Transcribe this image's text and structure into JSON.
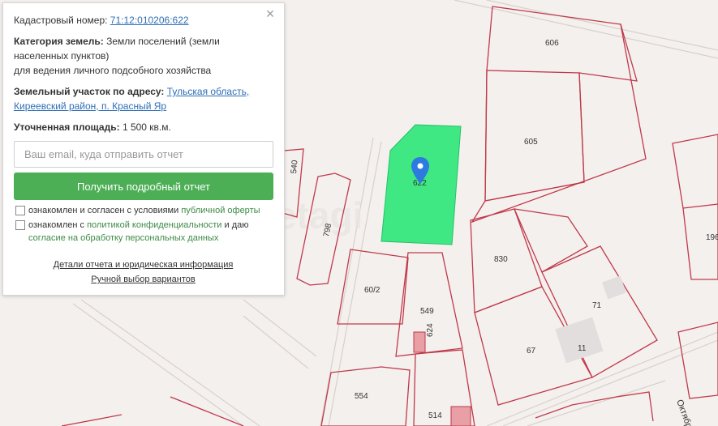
{
  "panel": {
    "close_symbol": "×",
    "cadastral_label": "Кадастровый номер:",
    "cadastral_number": "71:12:010206:622",
    "category_label": "Категория земель:",
    "category_line1": "Земли поселений (земли",
    "category_line2": "населенных пунктов)",
    "category_line3": "для ведения личного подсобного хозяйства",
    "address_label": "Земельный участок по адресу:",
    "address_line1": "Тульская область,",
    "address_line2": "Киреевский район, п. Красный Яр",
    "area_label": "Уточненная площадь:",
    "area_value": "1 500 кв.м.",
    "email_placeholder": "Ваш email, куда отправить отчет",
    "submit_label": "Получить подробный отчет",
    "offer_prefix": "ознакомлен и согласен с условиями",
    "offer_link": "публичной оферты",
    "privacy_prefix": "ознакомлен с",
    "privacy_link": "политикой конфиденциальности",
    "privacy_mid": "и даю",
    "consent_link": "согласие на обработку персональных данных",
    "details_link": "Детали отчета и юридическая информация",
    "manual_link": "Ручной выбор вариантов"
  },
  "map": {
    "watermark": "etagi",
    "street": "Октябр",
    "selected_label": "622",
    "parcel_labels": [
      "606",
      "605",
      "540",
      "798",
      "196",
      "830",
      "71",
      "60/2",
      "549",
      "624",
      "67",
      "11",
      "554",
      "514"
    ]
  },
  "colors": {
    "selected_fill": "#3fe882",
    "parcel_border": "#c0394a",
    "marker": "#2d7be0",
    "button": "#4cae55",
    "link": "#2e6eb5"
  }
}
